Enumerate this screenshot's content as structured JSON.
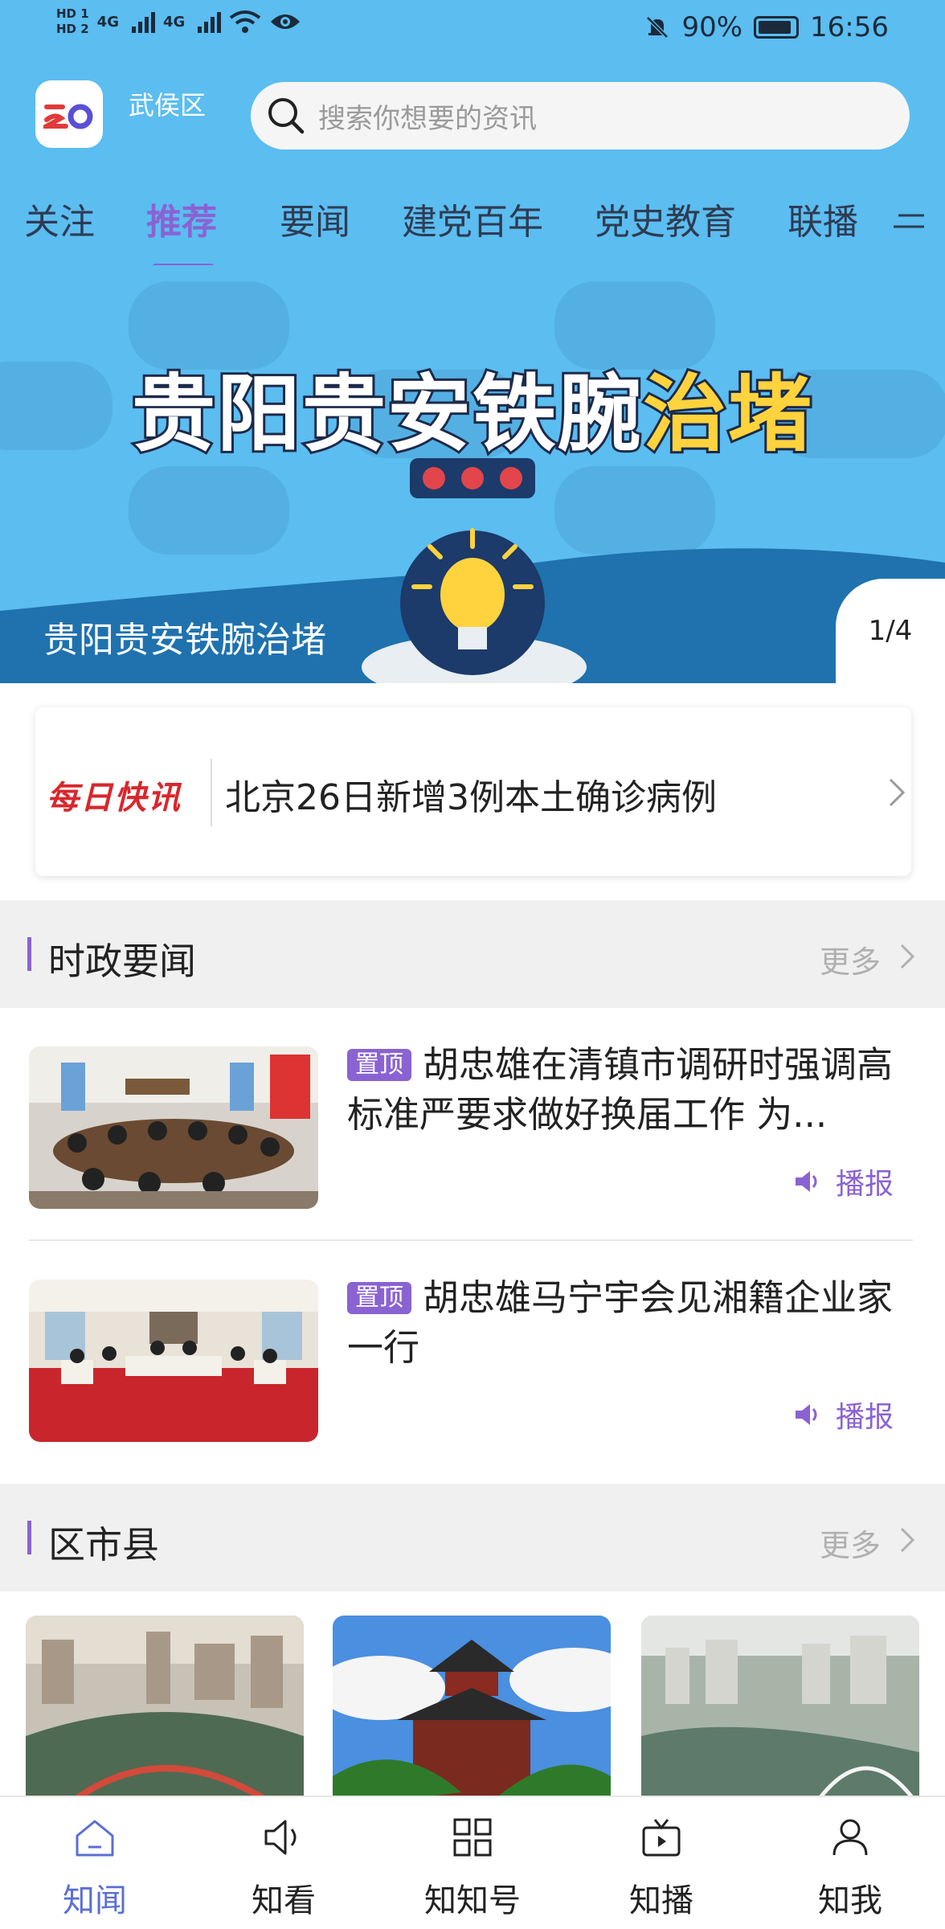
{
  "status_bar": {
    "hd1": "HD 1",
    "hd2": "HD 2",
    "net1": "4G",
    "net2": "4G",
    "battery": "90%",
    "time": "16:56"
  },
  "header": {
    "district": "武侯区",
    "search_placeholder": "搜索你想要的资讯"
  },
  "tabs": [
    "关注",
    "推荐",
    "要闻",
    "建党百年",
    "党史教育",
    "联播"
  ],
  "active_tab": "推荐",
  "banner": {
    "title_main": "贵阳贵安铁腕",
    "title_highlight": "治堵",
    "caption": "贵阳贵安铁腕治堵",
    "counter": "1/4"
  },
  "quick_news": {
    "badge": "每日快讯",
    "text": "北京26日新增3例本土确诊病例"
  },
  "section_politics": {
    "title": "时政要闻",
    "more": "更多"
  },
  "news": [
    {
      "pin": "置顶",
      "title": "胡忠雄在清镇市调研时强调高标准严要求做好换届工作  为...",
      "broadcast": "播报"
    },
    {
      "pin": "置顶",
      "title": "胡忠雄马宁宇会见湘籍企业家一行",
      "broadcast": "播报"
    }
  ],
  "section_county": {
    "title": "区市县",
    "more": "更多"
  },
  "bottom_nav": [
    {
      "label": "知闻",
      "icon": "home-icon",
      "active": true
    },
    {
      "label": "知看",
      "icon": "speaker-icon",
      "active": false
    },
    {
      "label": "知知号",
      "icon": "grid-icon",
      "active": false
    },
    {
      "label": "知播",
      "icon": "tv-play-icon",
      "active": false
    },
    {
      "label": "知我",
      "icon": "user-icon",
      "active": false
    }
  ],
  "colors": {
    "header_blue": "#5bbdf0",
    "accent_purple": "#8a63d2",
    "nav_active": "#5a6fd6",
    "quick_red": "#d7282e",
    "banner_yellow": "#ffd33d"
  }
}
